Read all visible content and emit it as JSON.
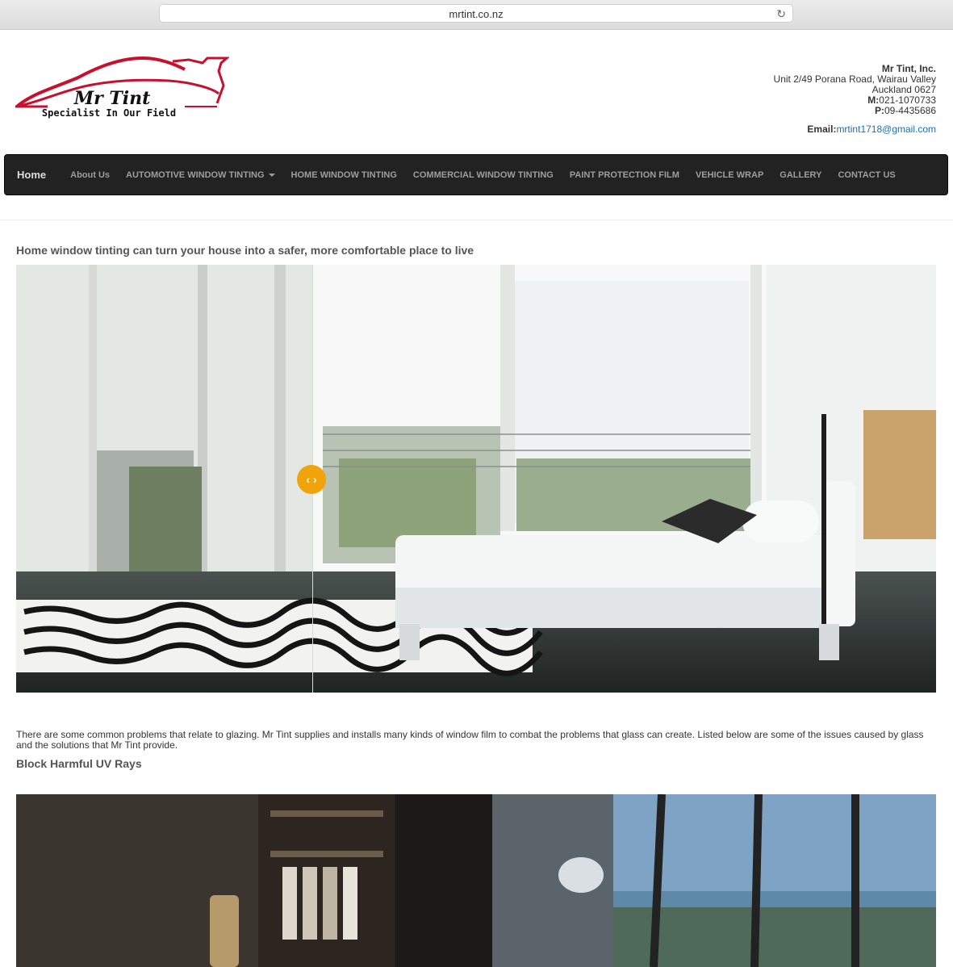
{
  "browser": {
    "url": "mrtint.co.nz"
  },
  "logo": {
    "brand": "Mr Tint",
    "tagline": "Specialist In Our Field"
  },
  "contact": {
    "company": "Mr Tint, Inc.",
    "address_line1": "Unit 2/49 Porana Road, Wairau Valley",
    "address_line2": "Auckland 0627",
    "mobile_label": "M:",
    "mobile": "021-1070733",
    "phone_label": "P:",
    "phone": "09-4435686",
    "email_label": "Email:",
    "email": "mrtint1718@gmail.com"
  },
  "nav": {
    "items": [
      {
        "label": "Home"
      },
      {
        "label": "About Us"
      },
      {
        "label": "AUTOMOTIVE WINDOW TINTING"
      },
      {
        "label": "HOME WINDOW TINTING"
      },
      {
        "label": "COMMERCIAL WINDOW TINTING"
      },
      {
        "label": "PAINT PROTECTION FILM"
      },
      {
        "label": "VEHICLE WRAP"
      },
      {
        "label": "GALLERY"
      },
      {
        "label": "CONTACT US"
      }
    ]
  },
  "main": {
    "heading": "Home window tinting can turn your house into a safer, more comfortable place to live",
    "comparison_handle": "‹ ›",
    "intro": "There are some common problems that relate to glazing. Mr Tint supplies and installs many kinds of window film to combat the problems that glass can create. Listed below are some of the issues caused by glass and the solutions that Mr Tint provide.",
    "section1_heading": "Block Harmful UV Rays"
  },
  "colors": {
    "navbar": "#222222",
    "accent": "#f0a30a",
    "logo_red": "#c8102e",
    "link": "#1a6fb5"
  }
}
